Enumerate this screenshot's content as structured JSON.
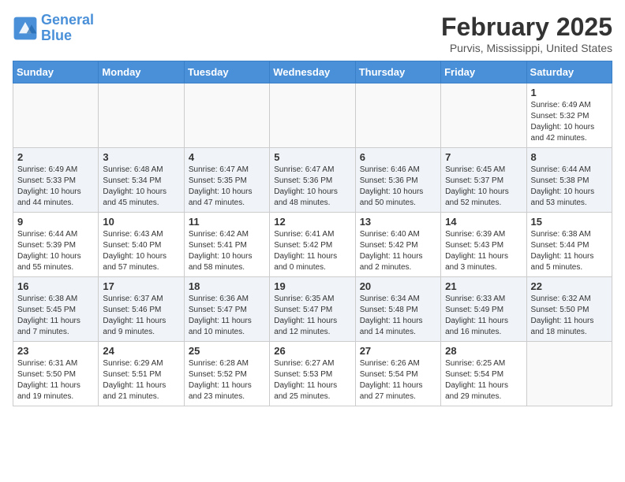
{
  "logo": {
    "line1": "General",
    "line2": "Blue"
  },
  "title": "February 2025",
  "location": "Purvis, Mississippi, United States",
  "weekdays": [
    "Sunday",
    "Monday",
    "Tuesday",
    "Wednesday",
    "Thursday",
    "Friday",
    "Saturday"
  ],
  "weeks": [
    [
      {
        "day": "",
        "info": ""
      },
      {
        "day": "",
        "info": ""
      },
      {
        "day": "",
        "info": ""
      },
      {
        "day": "",
        "info": ""
      },
      {
        "day": "",
        "info": ""
      },
      {
        "day": "",
        "info": ""
      },
      {
        "day": "1",
        "info": "Sunrise: 6:49 AM\nSunset: 5:32 PM\nDaylight: 10 hours\nand 42 minutes."
      }
    ],
    [
      {
        "day": "2",
        "info": "Sunrise: 6:49 AM\nSunset: 5:33 PM\nDaylight: 10 hours\nand 44 minutes."
      },
      {
        "day": "3",
        "info": "Sunrise: 6:48 AM\nSunset: 5:34 PM\nDaylight: 10 hours\nand 45 minutes."
      },
      {
        "day": "4",
        "info": "Sunrise: 6:47 AM\nSunset: 5:35 PM\nDaylight: 10 hours\nand 47 minutes."
      },
      {
        "day": "5",
        "info": "Sunrise: 6:47 AM\nSunset: 5:36 PM\nDaylight: 10 hours\nand 48 minutes."
      },
      {
        "day": "6",
        "info": "Sunrise: 6:46 AM\nSunset: 5:36 PM\nDaylight: 10 hours\nand 50 minutes."
      },
      {
        "day": "7",
        "info": "Sunrise: 6:45 AM\nSunset: 5:37 PM\nDaylight: 10 hours\nand 52 minutes."
      },
      {
        "day": "8",
        "info": "Sunrise: 6:44 AM\nSunset: 5:38 PM\nDaylight: 10 hours\nand 53 minutes."
      }
    ],
    [
      {
        "day": "9",
        "info": "Sunrise: 6:44 AM\nSunset: 5:39 PM\nDaylight: 10 hours\nand 55 minutes."
      },
      {
        "day": "10",
        "info": "Sunrise: 6:43 AM\nSunset: 5:40 PM\nDaylight: 10 hours\nand 57 minutes."
      },
      {
        "day": "11",
        "info": "Sunrise: 6:42 AM\nSunset: 5:41 PM\nDaylight: 10 hours\nand 58 minutes."
      },
      {
        "day": "12",
        "info": "Sunrise: 6:41 AM\nSunset: 5:42 PM\nDaylight: 11 hours\nand 0 minutes."
      },
      {
        "day": "13",
        "info": "Sunrise: 6:40 AM\nSunset: 5:42 PM\nDaylight: 11 hours\nand 2 minutes."
      },
      {
        "day": "14",
        "info": "Sunrise: 6:39 AM\nSunset: 5:43 PM\nDaylight: 11 hours\nand 3 minutes."
      },
      {
        "day": "15",
        "info": "Sunrise: 6:38 AM\nSunset: 5:44 PM\nDaylight: 11 hours\nand 5 minutes."
      }
    ],
    [
      {
        "day": "16",
        "info": "Sunrise: 6:38 AM\nSunset: 5:45 PM\nDaylight: 11 hours\nand 7 minutes."
      },
      {
        "day": "17",
        "info": "Sunrise: 6:37 AM\nSunset: 5:46 PM\nDaylight: 11 hours\nand 9 minutes."
      },
      {
        "day": "18",
        "info": "Sunrise: 6:36 AM\nSunset: 5:47 PM\nDaylight: 11 hours\nand 10 minutes."
      },
      {
        "day": "19",
        "info": "Sunrise: 6:35 AM\nSunset: 5:47 PM\nDaylight: 11 hours\nand 12 minutes."
      },
      {
        "day": "20",
        "info": "Sunrise: 6:34 AM\nSunset: 5:48 PM\nDaylight: 11 hours\nand 14 minutes."
      },
      {
        "day": "21",
        "info": "Sunrise: 6:33 AM\nSunset: 5:49 PM\nDaylight: 11 hours\nand 16 minutes."
      },
      {
        "day": "22",
        "info": "Sunrise: 6:32 AM\nSunset: 5:50 PM\nDaylight: 11 hours\nand 18 minutes."
      }
    ],
    [
      {
        "day": "23",
        "info": "Sunrise: 6:31 AM\nSunset: 5:50 PM\nDaylight: 11 hours\nand 19 minutes."
      },
      {
        "day": "24",
        "info": "Sunrise: 6:29 AM\nSunset: 5:51 PM\nDaylight: 11 hours\nand 21 minutes."
      },
      {
        "day": "25",
        "info": "Sunrise: 6:28 AM\nSunset: 5:52 PM\nDaylight: 11 hours\nand 23 minutes."
      },
      {
        "day": "26",
        "info": "Sunrise: 6:27 AM\nSunset: 5:53 PM\nDaylight: 11 hours\nand 25 minutes."
      },
      {
        "day": "27",
        "info": "Sunrise: 6:26 AM\nSunset: 5:54 PM\nDaylight: 11 hours\nand 27 minutes."
      },
      {
        "day": "28",
        "info": "Sunrise: 6:25 AM\nSunset: 5:54 PM\nDaylight: 11 hours\nand 29 minutes."
      },
      {
        "day": "",
        "info": ""
      }
    ]
  ]
}
